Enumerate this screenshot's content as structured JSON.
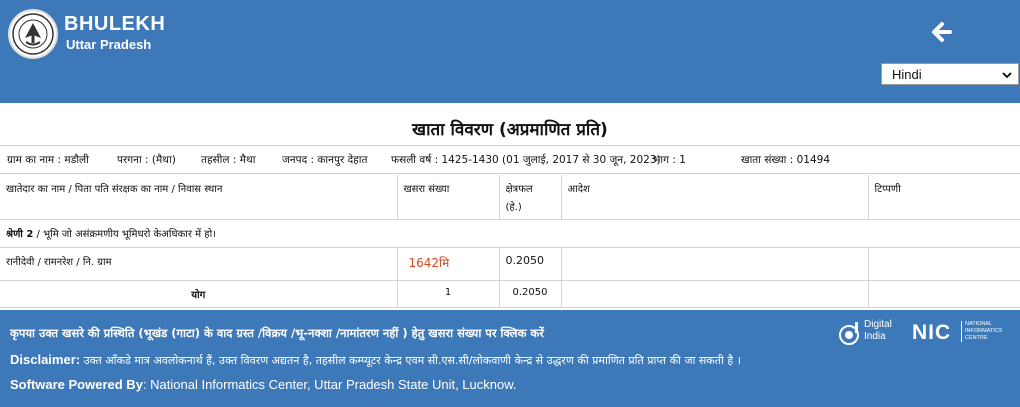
{
  "header": {
    "brand_title": "BHULEKH",
    "brand_subtitle": "Uttar Pradesh",
    "language": "Hindi",
    "colors": {
      "header_bg": "#3d78b8",
      "link": "#d0491f"
    }
  },
  "document": {
    "title": "खाता विवरण (अप्रमाणित प्रति)",
    "meta": {
      "village": "ग्राम का नाम : मडौली",
      "pargana": "परगना : (मैथा)",
      "tehsil": "तहसील : मैथा",
      "district": "जनपद : कानपुर देहात",
      "fasli": "फसली वर्ष : 1425-1430 (01 जुलाई, 2017 से 30 जून, 2023)",
      "bhag": "भाग : 1",
      "khata": "खाता संख्या : 01494"
    }
  },
  "table": {
    "headers": {
      "owner": "खातेदार का नाम / पिता पति संरक्षक का नाम / निवास स्थान",
      "khasra": "खसरा संख्या",
      "area_line1": "क्षेत्रफल",
      "area_line2": "(हे.)",
      "order": "आदेश",
      "remark": "टिप्पणी"
    },
    "category": {
      "prefix": "श्रेणी 2",
      "text": " / भूमि जो असंक्रमणीय भूमिधरो केअधिकार में हो।"
    },
    "rows": [
      {
        "owner": "रानीदेवी / रामनरेश / नि. ग्राम",
        "khasra": "1642मि",
        "area": "0.2050",
        "order": "",
        "remark": ""
      }
    ],
    "total": {
      "label": "योग",
      "count": "1",
      "area": "0.2050"
    }
  },
  "footer": {
    "note": "कृपया उक्त खसरे की प्रस्थिति (भूखंड (गाटा) के वाद ग्रस्त /विक्रय /भू-नक्शा /नामांतरण नहीं ) हेतु खसरा संख्या पर क्लिक करें",
    "disclaimer_label": "Disclaimer:",
    "disclaimer_text": " उक्त आँकडे मात्र अवलोकनार्थ हैं, उक्त विवरण अद्यतन है, तहसील कम्प्यूटर केन्द्र एवम सी.एस.सी/लोकवाणी केन्द्र से उद्धरण की प्रमाणित प्रति प्राप्त की जा सकती है ।",
    "software_label": "Software Powered By",
    "software_text": ": National Informatics Center, Uttar Pradesh State Unit, Lucknow.",
    "digital_india_line1": "Digital",
    "digital_india_line2": "India",
    "nic_line1": "NATIONAL",
    "nic_line2": "INFORMATICS",
    "nic_line3": "CENTRE",
    "nic_wordmark": "NIC"
  }
}
